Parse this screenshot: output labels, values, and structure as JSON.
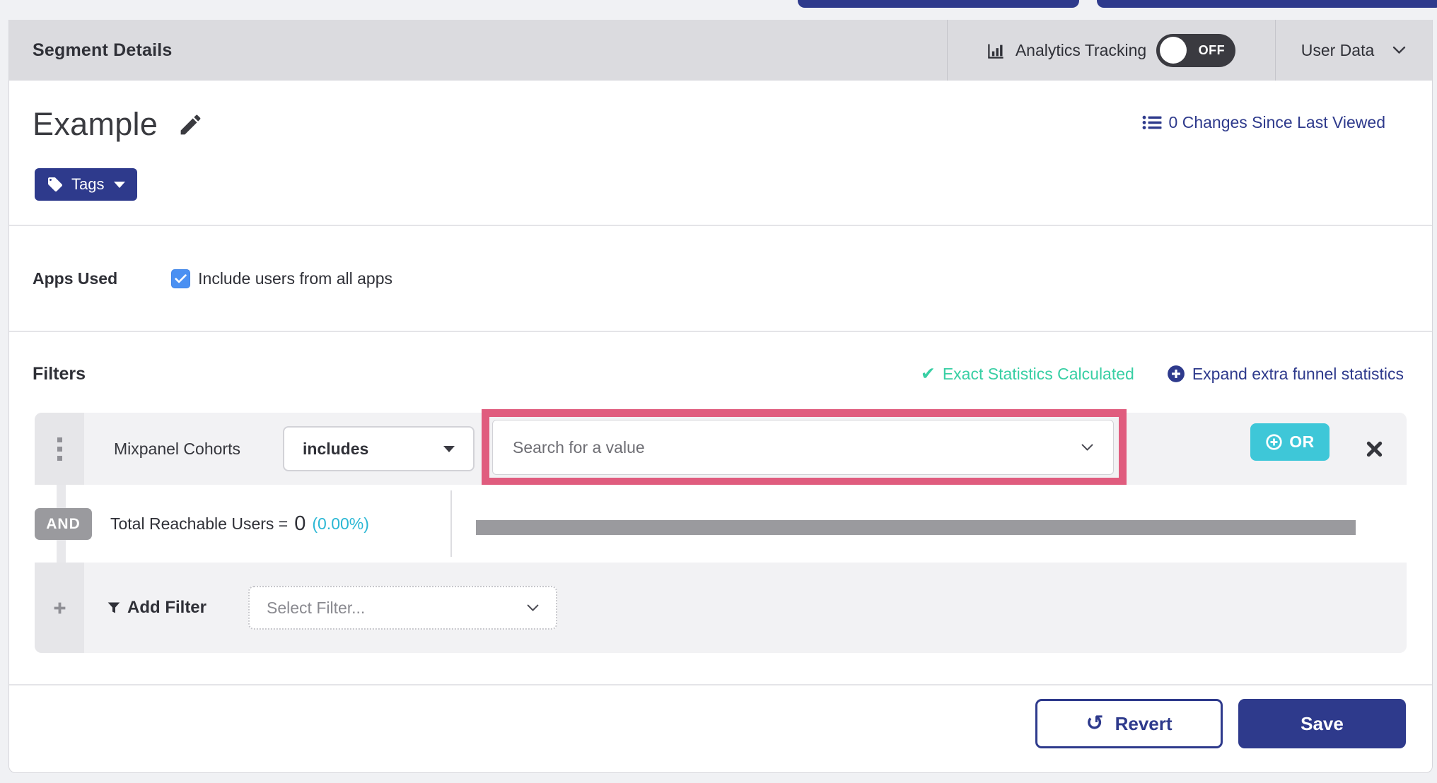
{
  "header": {
    "title": "Segment Details",
    "analytics_label": "Analytics Tracking",
    "toggle_state": "OFF",
    "user_data_label": "User Data"
  },
  "segment": {
    "name": "Example",
    "tags_label": "Tags",
    "changes_link": "0 Changes Since Last Viewed"
  },
  "apps": {
    "label": "Apps Used",
    "include_label": "Include users from all apps",
    "checked": true
  },
  "filters": {
    "heading": "Filters",
    "exact_statistics": "Exact Statistics Calculated",
    "expand_link": "Expand extra funnel statistics",
    "row": {
      "field": "Mixpanel Cohorts",
      "operator": "includes",
      "value_placeholder": "Search for a value",
      "or_label": "OR"
    },
    "and_label": "AND",
    "reachable": {
      "label": "Total Reachable Users =",
      "value": "0",
      "percent": "(0.00%)",
      "progress_percent": 0
    },
    "add": {
      "label": "Add Filter",
      "placeholder": "Select Filter..."
    }
  },
  "footer": {
    "revert": "Revert",
    "save": "Save"
  },
  "colors": {
    "indigo": "#2e3a8c",
    "teal_or_button": "#3ec7d8",
    "success_green": "#38cfa4",
    "percent_cyan": "#2bb7d4",
    "highlight_pink": "#e05c7e",
    "checkbox_blue": "#4a90f2",
    "toggle_off_bg": "#3a3a40",
    "bar_gray": "#9a9a9e",
    "topbar_gray": "#dbdbdf"
  }
}
